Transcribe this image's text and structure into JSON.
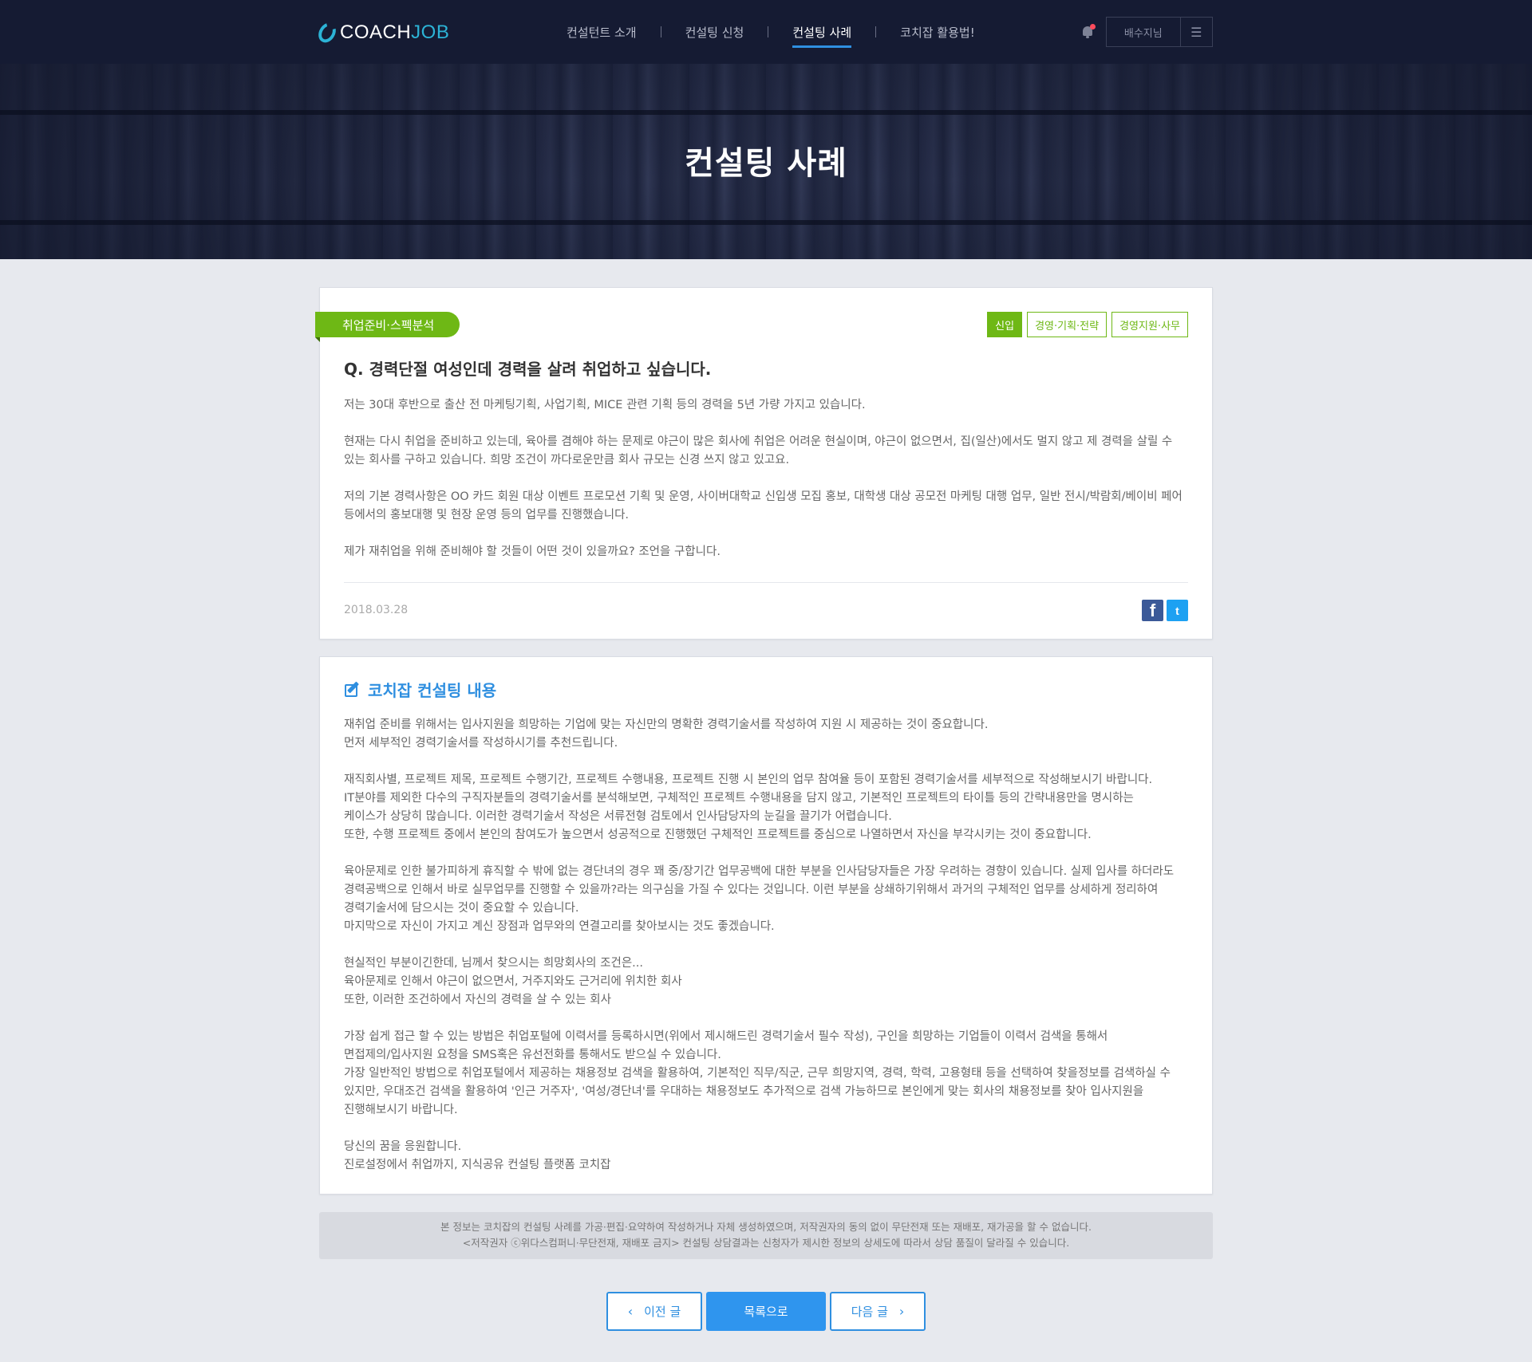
{
  "header": {
    "logo": {
      "coach": "COACH",
      "job": "JOB"
    },
    "nav": [
      {
        "label": "컨설턴트 소개",
        "active": false
      },
      {
        "label": "컨설팅 신청",
        "active": false
      },
      {
        "label": "컨설팅 사례",
        "active": true
      },
      {
        "label": "코치잡 활용법!",
        "active": false
      }
    ],
    "user_name": "배수지님",
    "menu_glyph": "☰",
    "notification_icon": "bell-icon",
    "notification_dot_color": "#ff4b5c"
  },
  "hero": {
    "title": "컨설팅 사례"
  },
  "question": {
    "category": "취업준비·스펙분석",
    "tags": [
      {
        "label": "신입",
        "filled": true
      },
      {
        "label": "경영·기획·전략",
        "filled": false
      },
      {
        "label": "경영지원·사무",
        "filled": false
      }
    ],
    "title": "Q.  경력단절 여성인데 경력을 살려 취업하고 싶습니다.",
    "paragraphs": [
      [
        "저는 30대 후반으로 출산 전 마케팅기획, 사업기획, MICE 관련 기획 등의 경력을 5년 가량 가지고 있습니다."
      ],
      [
        "현재는 다시 취업을 준비하고 있는데, 육아를 겸해야 하는 문제로 야근이 많은 회사에 취업은 어려운 현실이며, 야근이 없으면서, 집(일산)에서도 멀지 않고 제 경력을 살릴 수",
        "있는 회사를 구하고 있습니다. 희망 조건이 까다로운만큼 회사 규모는 신경 쓰지 않고 있고요."
      ],
      [
        "저의 기본 경력사항은 OO 카드 회원 대상 이벤트 프로모션 기획 및 운영, 사이버대학교 신입생 모집 홍보, 대학생 대상 공모전 마케팅 대행 업무, 일반 전시/박람회/베이비 페어",
        "등에서의 홍보대행 및 현장 운영 등의 업무를 진행했습니다."
      ],
      [
        "제가 재취업을 위해 준비해야 할 것들이 어떤 것이 있을까요? 조언을 구합니다."
      ]
    ],
    "date": "2018.03.28",
    "share": [
      {
        "name": "facebook",
        "glyph": "f",
        "icon": "facebook-icon",
        "color": "#3b5998"
      },
      {
        "name": "twitter",
        "glyph": "t",
        "icon": "twitter-icon",
        "color": "#1da1f2"
      }
    ]
  },
  "answer": {
    "title": "코치잡 컨설팅 내용",
    "title_icon": "edit-icon",
    "accent_color": "#2f8fe0",
    "paragraphs": [
      [
        "재취업 준비를 위해서는 입사지원을 희망하는 기업에 맞는 자신만의 명확한 경력기술서를 작성하여 지원 시 제공하는 것이 중요합니다.",
        "먼저 세부적인 경력기술서를 작성하시기를 추천드립니다."
      ],
      [
        "재직회사별, 프로젝트 제목, 프로젝트 수행기간, 프로젝트 수행내용, 프로젝트 진행 시 본인의 업무 참여율 등이 포함된 경력기술서를 세부적으로 작성해보시기 바랍니다.",
        "IT분야를 제외한 다수의 구직자분들의 경력기술서를 분석해보면, 구체적인 프로젝트 수행내용을 담지 않고, 기본적인 프로젝트의 타이틀 등의 간략내용만을 명시하는",
        "케이스가 상당히 많습니다. 이러한 경력기술서 작성은 서류전형 검토에서 인사담당자의 눈길을 끌기가 어렵습니다.",
        "또한, 수행 프로젝트 중에서 본인의 참여도가 높으면서 성공적으로 진행했던 구체적인 프로젝트를 중심으로 나열하면서 자신을 부각시키는 것이 중요합니다."
      ],
      [
        "육아문제로 인한 불가피하게 휴직할 수 밖에 없는 경단녀의 경우 꽤 중/장기간 업무공백에 대한 부분을 인사담당자들은 가장 우려하는 경향이 있습니다. 실제 입사를 하더라도",
        "경력공백으로 인해서 바로 실무업무를 진행할 수 있을까?라는 의구심을 가질 수 있다는 것입니다. 이런 부분을 상쇄하기위해서 과거의 구체적인 업무를 상세하게 정리하여",
        "경력기술서에 담으시는 것이 중요할 수 있습니다.",
        "마지막으로 자신이 가지고 계신 장점과 업무와의 연결고리를 찾아보시는 것도 좋겠습니다."
      ],
      [
        "현실적인 부분이긴한데, 님께서 찾으시는 희망회사의 조건은...",
        "육아문제로 인해서 야근이 없으면서, 거주지와도 근거리에 위치한 회사",
        "또한, 이러한 조건하에서 자신의 경력을 살 수 있는 회사"
      ],
      [
        "가장 쉽게 접근 할 수 있는 방법은 취업포털에 이력서를 등록하시면(위에서 제시해드린 경력기술서 필수 작성), 구인을 희망하는 기업들이 이력서 검색을 통해서",
        "면접제의/입사지원 요청을 SMS혹은 유선전화를 통해서도 받으실 수 있습니다.",
        "가장 일반적인 방법으로 취업포털에서 제공하는 채용정보 검색을 활용하여, 기본적인 직무/직군, 근무 희망지역, 경력, 학력, 고용형태 등을 선택하여 찾을정보를 검색하실 수",
        "있지만, 우대조건 검색을 활용하여 '인근 거주자', '여성/경단녀'를 우대하는 채용정보도 추가적으로 검색 가능하므로 본인에게 맞는 회사의 채용정보를 찾아 입사지원을",
        "진행해보시기 바랍니다."
      ],
      [
        "당신의 꿈을 응원합니다.",
        "진로설정에서 취업까지, 지식공유 컨설팅 플랫폼 코치잡"
      ]
    ]
  },
  "notice": {
    "lines": [
      "본 정보는 코치잡의 컨설팅 사례를 가공·편집·요약하여 작성하거나 자체 생성하였으며, 저작권자의 동의 없이 무단전재 또는 재배포, 재가공을 할 수 없습니다.",
      "<저작권자 ⓒ위다스컴퍼니·무단전재, 재배포 금지> 컨설팅 상담결과는 신청자가 제시한 정보의 상세도에 따라서 상담 품질이 달라질 수 있습니다."
    ]
  },
  "pager": {
    "prev_label": "이전 글",
    "list_label": "목록으로",
    "next_label": "다음 글",
    "prev_glyph": "‹",
    "next_glyph": "›"
  },
  "colors": {
    "header_bg": "#151b33",
    "brand_green": "#6eb815",
    "brand_blue": "#2f8fe0",
    "page_bg": "#e7e9ee"
  }
}
